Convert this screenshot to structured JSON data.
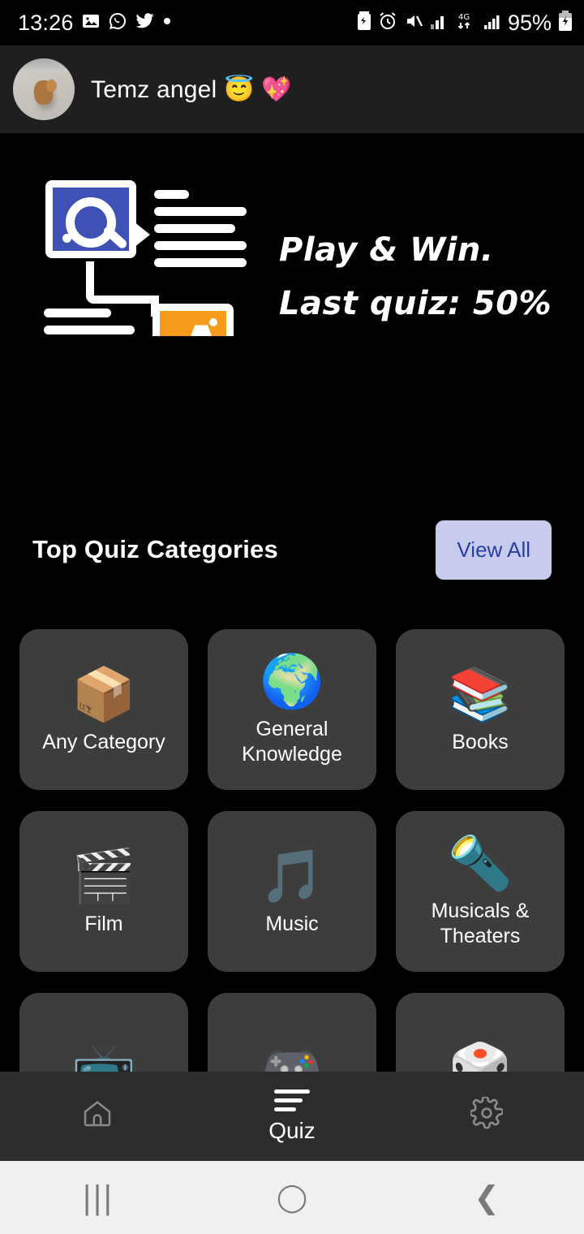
{
  "status_bar": {
    "time": "13:26",
    "left_icons": [
      "gallery-icon",
      "whatsapp-icon",
      "twitter-icon",
      "dot-icon"
    ],
    "right_icons": [
      "battery-saver-icon",
      "alarm-icon",
      "mute-icon",
      "signal-icon",
      "4g-data-icon",
      "signal2-icon"
    ],
    "network_label": "4G",
    "battery_percent": "95%"
  },
  "header": {
    "username": "Temz angel 😇 💖",
    "avatar_alt": "profile-photo"
  },
  "banner": {
    "line1": "Play & Win.",
    "line2": "Last quiz: 50%",
    "q_letter": "Q",
    "a_letter": "A"
  },
  "section": {
    "title": "Top Quiz Categories",
    "view_all_label": "View All"
  },
  "categories": [
    {
      "label": "Any Category",
      "icon": "📦",
      "icon_name": "mystery-box-icon"
    },
    {
      "label": "General Knowledge",
      "icon": "🌍",
      "icon_name": "globe-icon"
    },
    {
      "label": "Books",
      "icon": "📚",
      "icon_name": "books-icon"
    },
    {
      "label": "Film",
      "icon": "🎬",
      "icon_name": "clapperboard-icon"
    },
    {
      "label": "Music",
      "icon": "🎵",
      "icon_name": "music-note-icon"
    },
    {
      "label": "Musicals & Theaters",
      "icon": "🔦",
      "icon_name": "spotlights-icon"
    },
    {
      "label": "",
      "icon": "📺",
      "icon_name": "television-icon"
    },
    {
      "label": "",
      "icon": "🎮",
      "icon_name": "video-game-icon"
    },
    {
      "label": "",
      "icon": "🎲",
      "icon_name": "board-game-icon"
    }
  ],
  "bottom_nav": {
    "home_icon": "⌂",
    "quiz_label": "Quiz",
    "settings_icon": "⚙"
  },
  "android_nav": {
    "recents": "|||",
    "home": "◯",
    "back": "❮"
  },
  "colors": {
    "page_bg": "#000000",
    "header_bg": "#1f1f1f",
    "card_bg": "#3d3d3d",
    "accent_button_bg": "#c7cbee",
    "accent_button_text": "#2b3f9e",
    "nav_bg": "#2d2d2d",
    "android_nav_bg": "#f0f0f0",
    "q_card": "#3f51b5",
    "a_card": "#f79b1c"
  }
}
